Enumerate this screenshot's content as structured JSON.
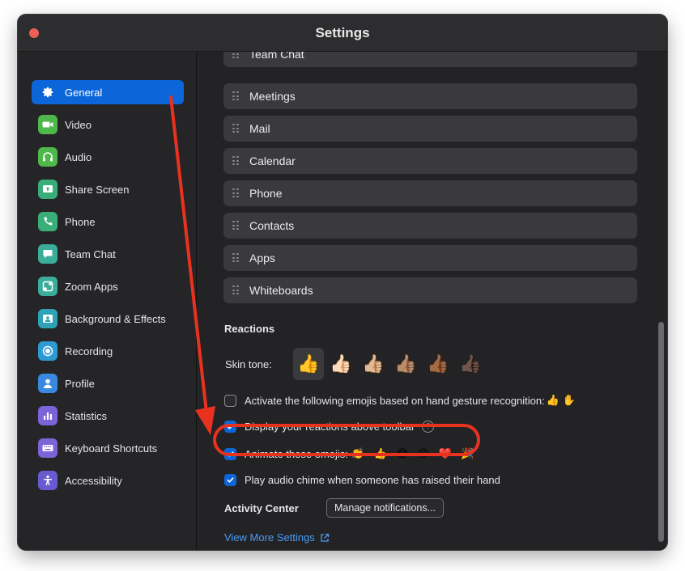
{
  "window": {
    "title": "Settings"
  },
  "sidebar": {
    "items": [
      {
        "label": "General",
        "icon": "gear-icon",
        "color": "#0d66d9",
        "active": true
      },
      {
        "label": "Video",
        "icon": "video-camera-icon",
        "color": "#4fb84a"
      },
      {
        "label": "Audio",
        "icon": "headphones-icon",
        "color": "#4fb84a"
      },
      {
        "label": "Share Screen",
        "icon": "share-screen-icon",
        "color": "#3aae7a"
      },
      {
        "label": "Phone",
        "icon": "phone-icon",
        "color": "#3aae7a"
      },
      {
        "label": "Team Chat",
        "icon": "chat-bubble-icon",
        "color": "#3aae9a"
      },
      {
        "label": "Zoom Apps",
        "icon": "apps-icon",
        "color": "#3aae9a"
      },
      {
        "label": "Background & Effects",
        "icon": "background-image-icon",
        "color": "#2ea3b8"
      },
      {
        "label": "Recording",
        "icon": "record-icon",
        "color": "#2e9ad4"
      },
      {
        "label": "Profile",
        "icon": "person-icon",
        "color": "#3a88e0"
      },
      {
        "label": "Statistics",
        "icon": "bar-chart-icon",
        "color": "#7a64d8"
      },
      {
        "label": "Keyboard Shortcuts",
        "icon": "keyboard-icon",
        "color": "#7a64d8"
      },
      {
        "label": "Accessibility",
        "icon": "accessibility-icon",
        "color": "#6a5ad0"
      }
    ]
  },
  "tabs": {
    "items": [
      {
        "label": "Team Chat"
      },
      {
        "label": "Meetings"
      },
      {
        "label": "Mail"
      },
      {
        "label": "Calendar"
      },
      {
        "label": "Phone"
      },
      {
        "label": "Contacts"
      },
      {
        "label": "Apps"
      },
      {
        "label": "Whiteboards"
      }
    ]
  },
  "reactions": {
    "title": "Reactions",
    "skin_tone_label": "Skin tone:",
    "skin_tones": [
      "👍",
      "👍🏻",
      "👍🏼",
      "👍🏽",
      "👍🏾",
      "👍🏿"
    ],
    "selected_tone_index": 0
  },
  "options": {
    "gesture": {
      "label": "Activate the following emojis based on hand gesture recognition:",
      "emojis": "👍✋",
      "checked": false
    },
    "display_above": {
      "label": "Display your reactions above toolbar",
      "checked": true,
      "help": "?"
    },
    "animate": {
      "label": "Animate these emojis:",
      "emojis": "👏 👍 😂 😮 ❤️ 🎉",
      "checked": true
    },
    "audio_chime": {
      "label": "Play audio chime when someone has raised their hand",
      "checked": true
    }
  },
  "activity_center": {
    "label": "Activity Center",
    "button": "Manage notifications..."
  },
  "footer": {
    "more_settings": "View More Settings"
  },
  "colors": {
    "accent": "#0d66d9",
    "annotation": "#e8321f",
    "link": "#4a9df5"
  }
}
